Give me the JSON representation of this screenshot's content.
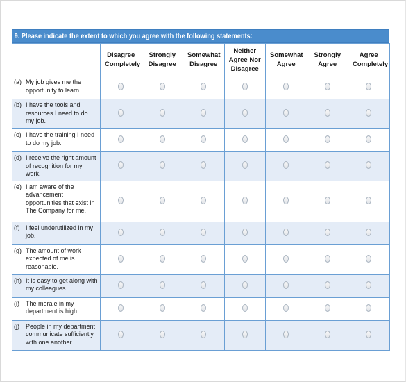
{
  "question": {
    "title": "9.  Please indicate the extent to which you agree with the following statements:"
  },
  "columns": [
    "Disagree Completely",
    "Strongly Disagree",
    "Somewhat Disagree",
    "Neither Agree Nor Disagree",
    "Somewhat Agree",
    "Strongly Agree",
    "Agree Completely"
  ],
  "rows": [
    {
      "letter": "(a)",
      "text": "My job gives me the opportunity to learn."
    },
    {
      "letter": "(b)",
      "text": "I have the tools and resources I need to do my job."
    },
    {
      "letter": "(c)",
      "text": "I have the training I need to do my job."
    },
    {
      "letter": "(d)",
      "text": "I receive the right amount of recognition for my work."
    },
    {
      "letter": "(e)",
      "text": "I am aware of the advancement opportunities that exist in The Company for me."
    },
    {
      "letter": "(f)",
      "text": "I feel underutilized in my job."
    },
    {
      "letter": "(g)",
      "text": "The amount of work expected of me is reasonable."
    },
    {
      "letter": "(h)",
      "text": "It is easy to get along with my colleagues."
    },
    {
      "letter": "(i)",
      "text": "The morale in my department is high."
    },
    {
      "letter": "(j)",
      "text": "People in my department communicate sufficiently with one another."
    }
  ],
  "colors": {
    "header_bg": "#4a8ccc",
    "alt_row_bg": "#e4ecf7",
    "grid": "#6a9fd4"
  }
}
